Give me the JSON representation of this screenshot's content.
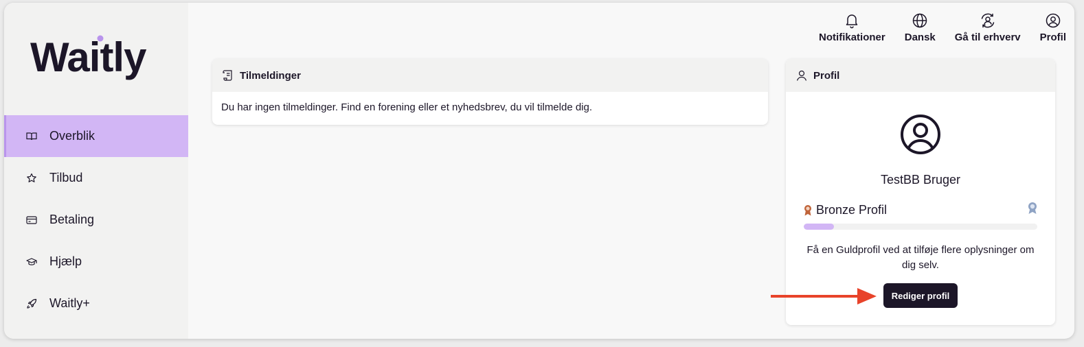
{
  "app": {
    "logo_text": "Waitly"
  },
  "sidebar": {
    "items": [
      {
        "label": "Overblik",
        "icon": "book-icon",
        "active": true
      },
      {
        "label": "Tilbud",
        "icon": "star-icon",
        "active": false
      },
      {
        "label": "Betaling",
        "icon": "card-icon",
        "active": false
      },
      {
        "label": "Hjælp",
        "icon": "graduation-cap-icon",
        "active": false
      },
      {
        "label": "Waitly+",
        "icon": "rocket-icon",
        "active": false
      }
    ]
  },
  "topbar": {
    "notifications": "Notifikationer",
    "language": "Dansk",
    "business": "Gå til erhverv",
    "profile": "Profil"
  },
  "subscriptions": {
    "title": "Tilmeldinger",
    "empty_text": "Du har ingen tilmeldinger. Find en forening eller et nyhedsbrev, du vil tilmelde dig."
  },
  "profile_card": {
    "title": "Profil",
    "user_name": "TestBB Bruger",
    "tier_label": "Bronze Profil",
    "progress_percent": 13,
    "hint": "Få en Guldprofil ved at tilføje flere oplysninger om dig selv.",
    "edit_button": "Rediger profil"
  },
  "colors": {
    "accent": "#d2b6f5",
    "dark": "#1c1628",
    "annotation_arrow": "#e8432a",
    "bronze": "#c0643a",
    "silver": "#8fa3c4"
  }
}
